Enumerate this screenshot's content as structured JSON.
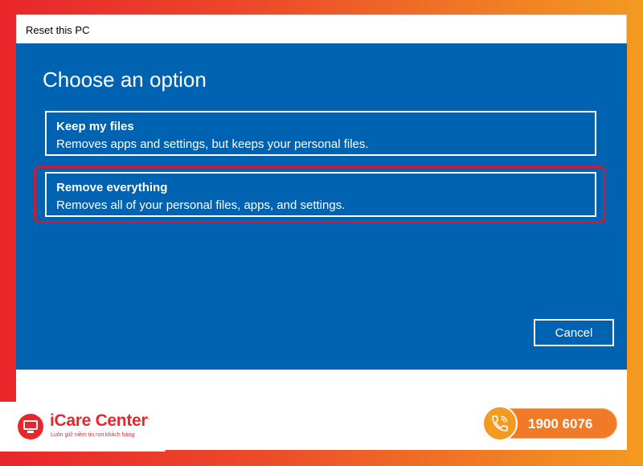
{
  "window": {
    "title": "Reset this PC"
  },
  "dialog": {
    "heading": "Choose an option",
    "options": [
      {
        "title": "Keep my files",
        "description": "Removes apps and settings, but keeps your personal files."
      },
      {
        "title": "Remove everything",
        "description": "Removes all of your personal files, apps, and settings."
      }
    ],
    "cancel_label": "Cancel"
  },
  "branding": {
    "logo_name": "iCare Center",
    "logo_registered": "®",
    "tagline": "Luôn giữ niềm tin nơi khách hàng",
    "phone": "1900 6076",
    "phone_icon": "phone-icon"
  },
  "colors": {
    "dialog_blue": "#0063b1",
    "highlight_red": "#c0203a",
    "brand_red": "#e8262b",
    "brand_orange": "#f07a25"
  }
}
